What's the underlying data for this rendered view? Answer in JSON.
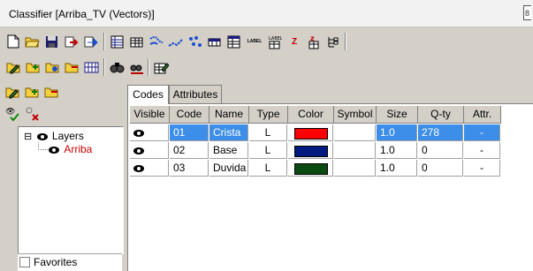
{
  "window": {
    "title": "Classifier [Arriba_TV (Vectors)]",
    "ctl_glyph": "8"
  },
  "tabs": [
    "Codes",
    "Attributes"
  ],
  "columns": [
    "Visible",
    "Code",
    "Name",
    "Type",
    "Color",
    "Symbol",
    "Size",
    "Q-ty",
    "Attr."
  ],
  "rows": [
    {
      "code": "01",
      "name": "Crista",
      "type": "L",
      "color": "#ff0000",
      "symbol": "",
      "size": "1.0",
      "qty": "278",
      "attr": "-",
      "selected": true
    },
    {
      "code": "02",
      "name": "Base",
      "type": "L",
      "color": "#001a80",
      "symbol": "",
      "size": "1.0",
      "qty": "0",
      "attr": "-",
      "selected": false
    },
    {
      "code": "03",
      "name": "Duvida",
      "type": "L",
      "color": "#0a4a12",
      "symbol": "",
      "size": "1.0",
      "qty": "0",
      "attr": "-",
      "selected": false
    }
  ],
  "tree": {
    "root": "Layers",
    "child": "Arriba",
    "expander": "⊟",
    "child_color": "#cc0000"
  },
  "favorites_label": "Favorites",
  "toolbar_labels": {
    "label1": "LABEL",
    "label2": "LABEL",
    "z": "Z"
  },
  "colors": {
    "selection": "#3d8ee8"
  }
}
